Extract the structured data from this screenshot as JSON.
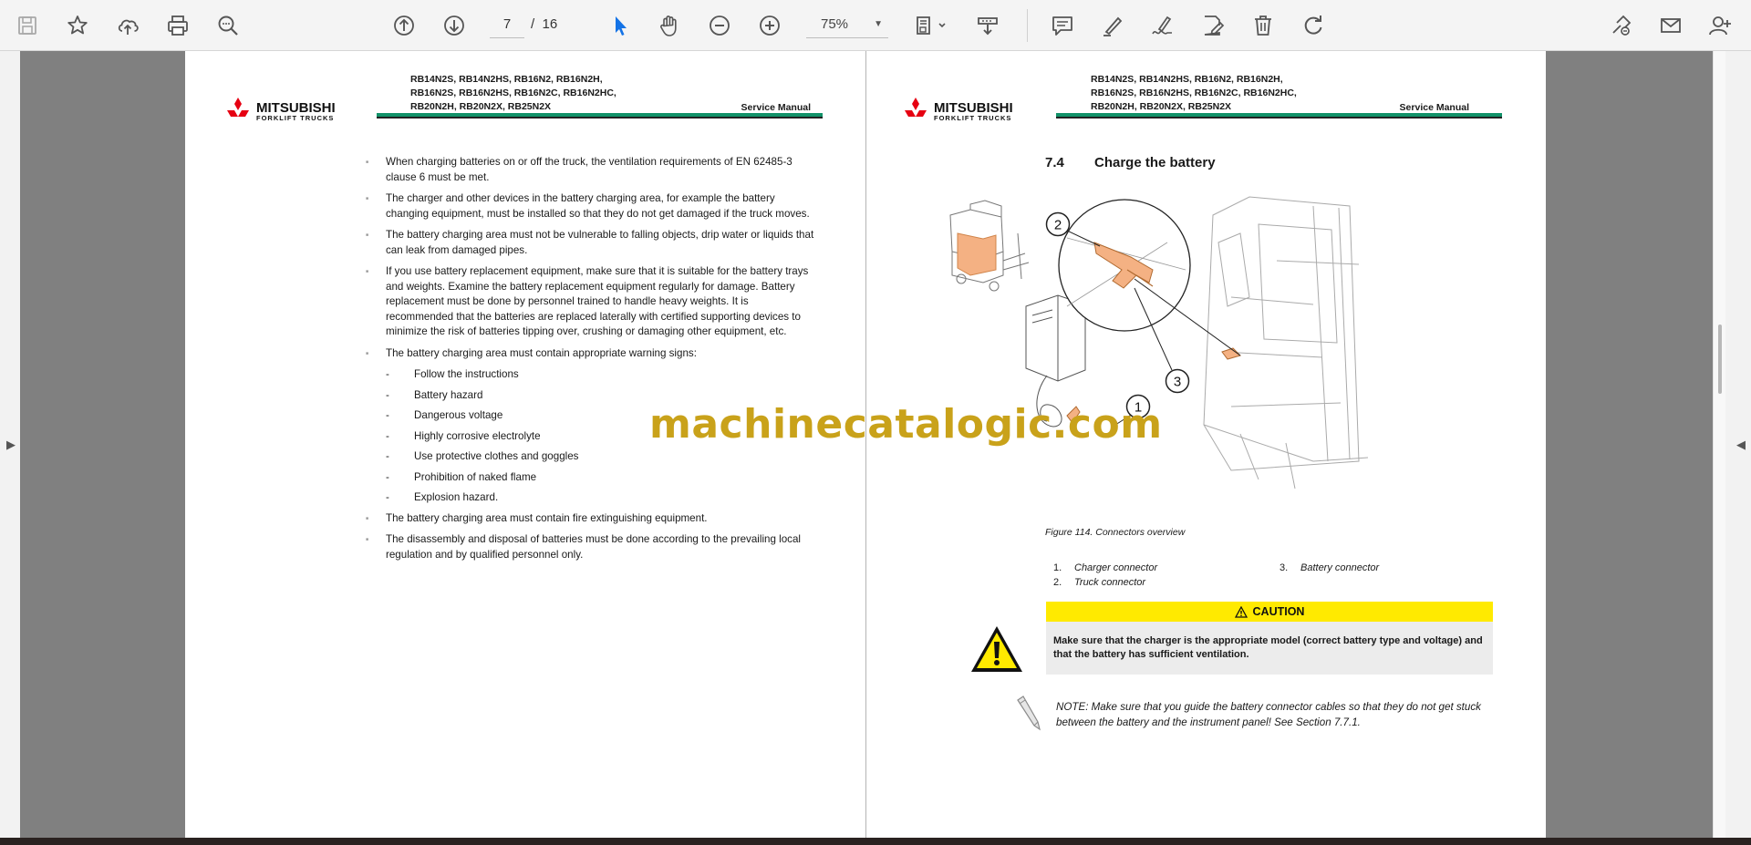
{
  "toolbar": {
    "page_current": "7",
    "page_separator": "/",
    "page_total": "16",
    "zoom": "75%",
    "icons": [
      "save-icon",
      "bookmark-star-icon",
      "cloud-upload-icon",
      "print-icon",
      "zoom-search-icon",
      "page-up-icon",
      "page-down-icon",
      "select-cursor-icon",
      "hand-pan-icon",
      "zoom-out-icon",
      "zoom-in-icon",
      "fit-page-icon",
      "download-icon",
      "comment-icon",
      "highlight-pen-icon",
      "sign-icon",
      "edit-pdf-icon",
      "delete-icon",
      "rotate-icon",
      "share-icon",
      "email-icon",
      "account-icon"
    ]
  },
  "header": {
    "logo_brand": "MITSUBISHI",
    "logo_sub": "FORKLIFT TRUCKS",
    "models_line1": "RB14N2S, RB14N2HS, RB16N2, RB16N2H,",
    "models_line2": "RB16N2S, RB16N2HS, RB16N2C, RB16N2HC,",
    "models_line3": "RB20N2H, RB20N2X, RB25N2X",
    "manual_label": "Service Manual"
  },
  "left_page": {
    "bullets": [
      "When charging batteries on or off the truck, the ventilation requirements of EN 62485-3 clause 6 must be met.",
      "The charger and other devices in the battery charging area, for example the battery changing equipment, must be installed so that they do not get damaged if the truck moves.",
      "The battery charging area must not be vulnerable to falling objects, drip water or liquids that can leak from damaged pipes.",
      "If you use battery replacement equipment, make sure that it is suitable for the battery trays and weights. Examine the battery replacement equipment regularly for damage. Battery replacement must be done by personnel trained to handle heavy weights. It is recommended that the batteries are replaced laterally with certified supporting devices to minimize the risk of batteries tipping over, crushing or damaging other equipment, etc.",
      "The battery charging area must contain appropriate warning signs:"
    ],
    "signs": [
      "Follow the instructions",
      "Battery hazard",
      "Dangerous voltage",
      "Highly corrosive electrolyte",
      "Use protective clothes and goggles",
      "Prohibition of naked flame",
      "Explosion hazard."
    ],
    "bullets_after": [
      "The battery charging area must contain fire extinguishing equipment.",
      "The disassembly and disposal of batteries must be done according to the prevailing local regulation and by qualified personnel only."
    ]
  },
  "right_page": {
    "section_number": "7.4",
    "section_title": "Charge the battery",
    "callouts": [
      "1",
      "2",
      "3"
    ],
    "figure_caption": "Figure 114. Connectors overview",
    "legend": [
      {
        "num": "1.",
        "label": "Charger connector"
      },
      {
        "num": "2.",
        "label": "Truck connector"
      },
      {
        "num": "3.",
        "label": "Battery connector"
      }
    ],
    "caution_title": "CAUTION",
    "caution_text": "Make sure that the charger is the appropriate model (correct battery type and voltage) and that the battery has sufficient ventilation.",
    "note_text": "NOTE: Make sure that you guide the battery connector cables so that they do not get stuck between the battery and the instrument panel! See Section 7.7.1."
  },
  "watermark": "machinecatalogic.com",
  "colors": {
    "accent_green": "#129269",
    "caution_yellow": "#ffea00",
    "watermark_gold": "#c9a21a",
    "logo_red": "#e60012",
    "cursor_blue": "#1473e6"
  }
}
